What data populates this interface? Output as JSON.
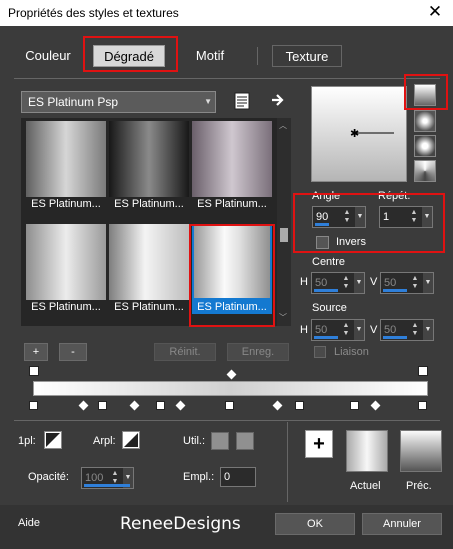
{
  "window": {
    "title": "Propriétés des styles et textures",
    "close_glyph": "✕"
  },
  "tabs": [
    {
      "label": "Couleur"
    },
    {
      "label": "Dégradé",
      "active": true
    },
    {
      "label": "Motif"
    },
    {
      "label": "Texture"
    }
  ],
  "gradient_combo": {
    "value": "ES Platinum Psp"
  },
  "gradients": [
    {
      "label": "ES Platinum..."
    },
    {
      "label": "ES Platinum..."
    },
    {
      "label": "ES Platinum..."
    },
    {
      "label": "ES Platinum..."
    },
    {
      "label": "ES Platinum..."
    },
    {
      "label": "ES Platinum...",
      "selected": true
    }
  ],
  "list_buttons": {
    "add": "+",
    "remove": "-",
    "reset": "Réinit.",
    "save": "Enreg."
  },
  "params": {
    "angle_label": "Angle",
    "angle_value": "90",
    "repeat_label": "Répét.",
    "repeat_value": "1",
    "invert_label": "Invers",
    "center_label": "Centre",
    "center_h_label": "H",
    "center_h": "50",
    "center_v_label": "V",
    "center_v": "50",
    "source_label": "Source",
    "source_h_label": "H",
    "source_h": "50",
    "source_v_label": "V",
    "source_v": "50",
    "link_label": "Liaison"
  },
  "stops": {
    "first": "1pl:",
    "arpl": "Arpl:",
    "util": "Util.:",
    "opacity_label": "Opacité:",
    "opacity_value": "100",
    "empl_label": "Empl.:",
    "empl_value": "0"
  },
  "preview": {
    "add": "+",
    "current": "Actuel",
    "previous": "Préc."
  },
  "footer": {
    "help": "Aide",
    "brand": "ReneeDesigns",
    "ok": "OK",
    "cancel": "Annuler"
  },
  "colors": {
    "accent": "#1479d0",
    "highlight": "#e01212"
  }
}
